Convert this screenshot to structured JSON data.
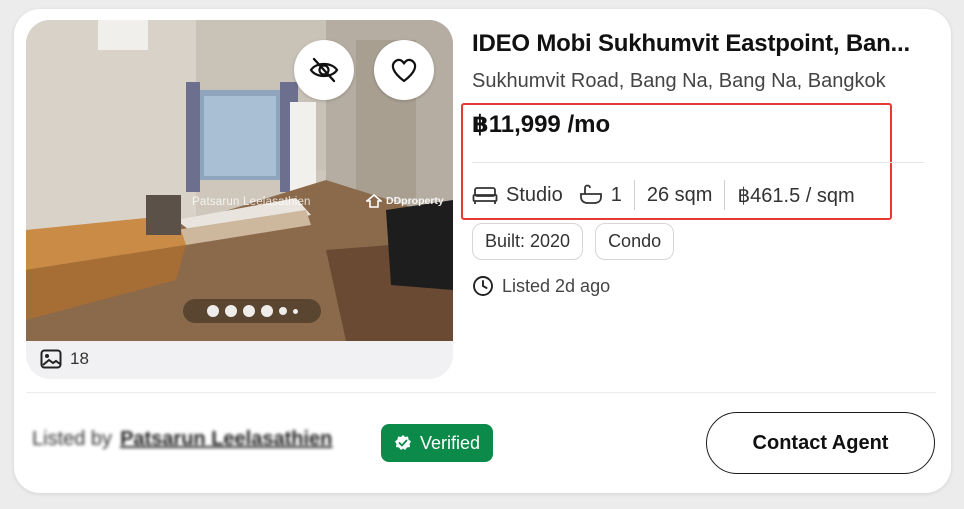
{
  "listing": {
    "title": "IDEO Mobi Sukhumvit Eastpoint, Ban...",
    "address": "Sukhumvit Road, Bang Na, Bang Na, Bangkok",
    "price": "฿11,999 /mo",
    "specs": {
      "bedroom": "Studio",
      "bathrooms": "1",
      "area": "26 sqm",
      "price_per_area": "฿461.5 / sqm"
    },
    "tags": [
      "Built: 2020",
      "Condo"
    ],
    "listed": "Listed 2d ago"
  },
  "gallery": {
    "photo_count": "18",
    "watermark_name": "Patsarun Leelasathien",
    "watermark_brand": "DDproperty",
    "current_photo": 1,
    "total_dots": 6
  },
  "agent": {
    "prefix": "Listed by",
    "name": "Patsarun Leelasathien",
    "verified_label": "Verified"
  },
  "actions": {
    "contact_label": "Contact Agent"
  },
  "icons": {
    "hide": "eye-off-icon",
    "favorite": "heart-icon",
    "photos": "image-icon",
    "bed": "bed-icon",
    "bath": "bathtub-icon",
    "clock": "clock-icon",
    "verified": "verified-badge-icon"
  },
  "colors": {
    "highlight": "#e53935",
    "verified_bg": "#0b8a4a"
  }
}
